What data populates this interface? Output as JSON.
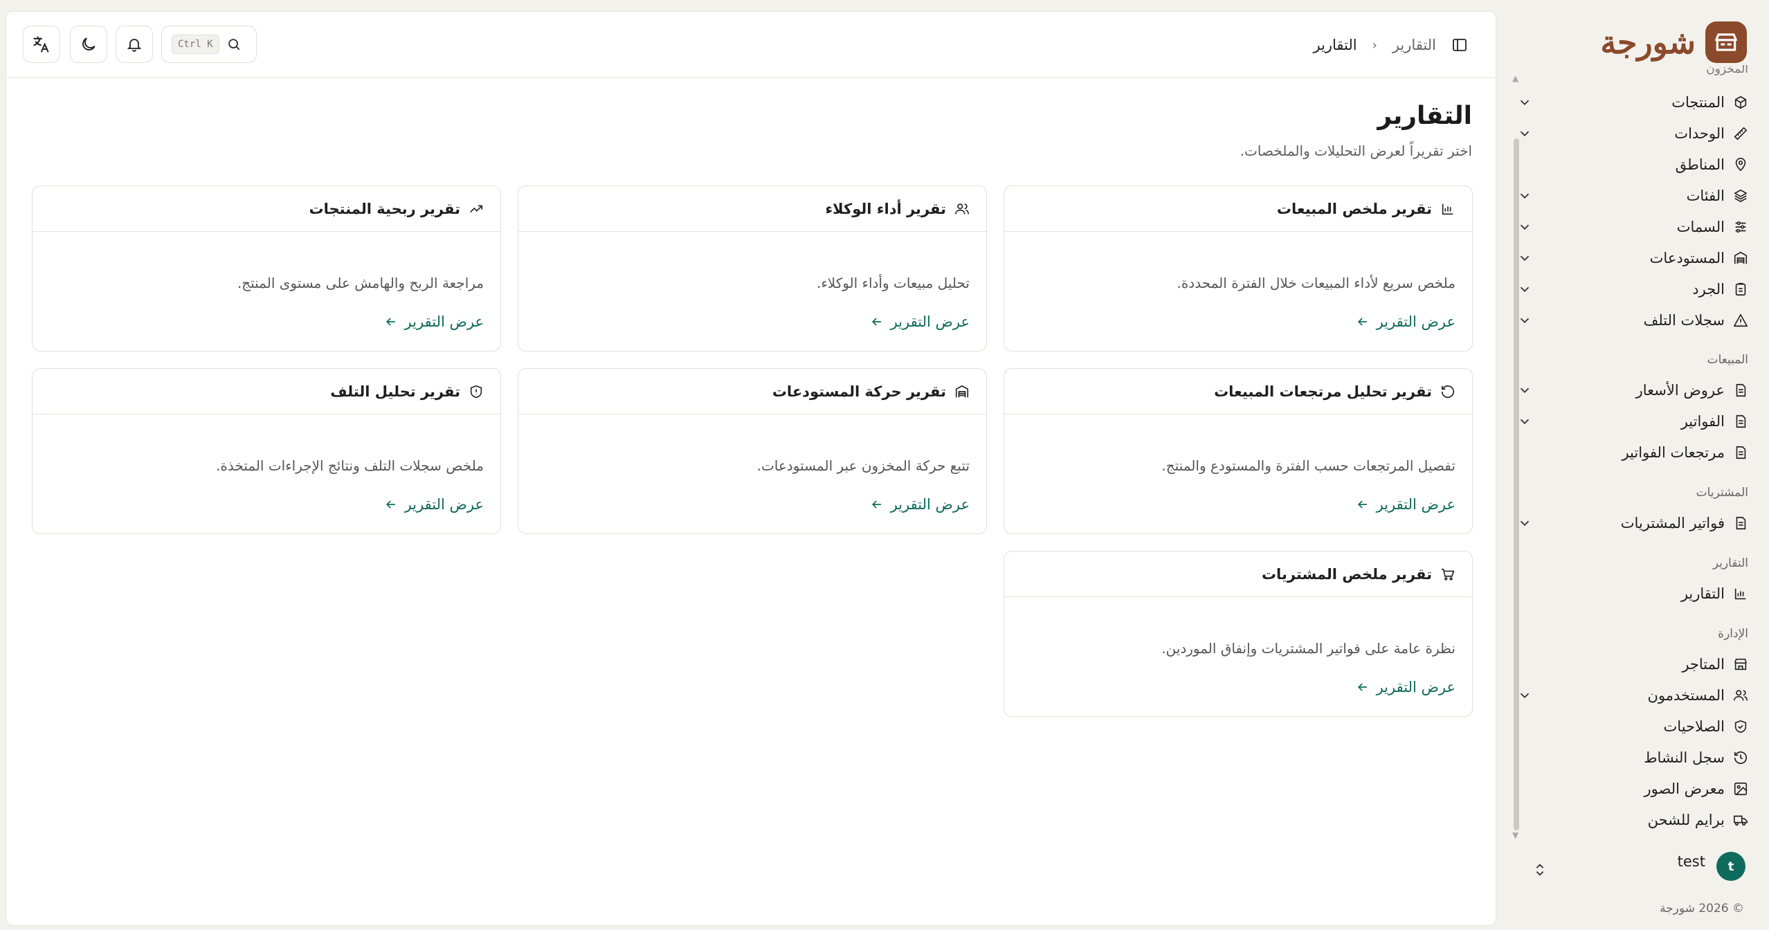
{
  "brand": {
    "name": "شورجة",
    "color": "#8b4a2b"
  },
  "sidebar": {
    "clipped_group": "المخزون",
    "groups": [
      {
        "items": [
          {
            "label": "المنتجات",
            "icon": "box-icon",
            "expandable": true
          },
          {
            "label": "الوحدات",
            "icon": "ruler-icon",
            "expandable": true
          },
          {
            "label": "المناطق",
            "icon": "map-pin-icon",
            "expandable": false
          },
          {
            "label": "الفئات",
            "icon": "layers-icon",
            "expandable": true
          },
          {
            "label": "السمات",
            "icon": "sliders-icon",
            "expandable": true
          },
          {
            "label": "المستودعات",
            "icon": "warehouse-icon",
            "expandable": true
          },
          {
            "label": "الجرد",
            "icon": "clipboard-icon",
            "expandable": true
          },
          {
            "label": "سجلات التلف",
            "icon": "alert-triangle-icon",
            "expandable": true
          }
        ]
      },
      {
        "title": "المبيعات",
        "items": [
          {
            "label": "عروض الأسعار",
            "icon": "file-icon",
            "expandable": true
          },
          {
            "label": "الفواتير",
            "icon": "file-icon",
            "expandable": true
          },
          {
            "label": "مرتجعات الفواتير",
            "icon": "file-icon",
            "expandable": false
          }
        ]
      },
      {
        "title": "المشتريات",
        "items": [
          {
            "label": "فواتير المشتريات",
            "icon": "file-icon",
            "expandable": true
          }
        ]
      },
      {
        "title": "التقارير",
        "items": [
          {
            "label": "التقارير",
            "icon": "bar-chart-icon",
            "expandable": false
          }
        ]
      },
      {
        "title": "الإدارة",
        "items": [
          {
            "label": "المتاجر",
            "icon": "store-icon",
            "expandable": false
          },
          {
            "label": "المستخدمون",
            "icon": "users-icon",
            "expandable": true
          },
          {
            "label": "الصلاحيات",
            "icon": "shield-check-icon",
            "expandable": false
          },
          {
            "label": "سجل النشاط",
            "icon": "history-icon",
            "expandable": false
          },
          {
            "label": "معرض الصور",
            "icon": "image-icon",
            "expandable": false
          },
          {
            "label": "برايم للشحن",
            "icon": "truck-icon",
            "expandable": false
          }
        ]
      }
    ],
    "user": {
      "name": "test",
      "initial": "t"
    },
    "copyright": "© 2026 شورجة"
  },
  "topbar": {
    "search_shortcut": "Ctrl K",
    "breadcrumb": [
      "التقارير",
      "التقارير"
    ]
  },
  "page": {
    "title": "التقارير",
    "subtitle": "اختر تقريراً لعرض التحليلات والملخصات."
  },
  "cards": [
    {
      "title": "تقرير ملخص المبيعات",
      "icon": "bar-chart-icon",
      "desc": "ملخص سريع لأداء المبيعات خلال الفترة المحددة.",
      "link": "عرض التقرير"
    },
    {
      "title": "تقرير أداء الوكلاء",
      "icon": "users-icon",
      "desc": "تحليل مبيعات وأداء الوكلاء.",
      "link": "عرض التقرير"
    },
    {
      "title": "تقرير ربحية المنتجات",
      "icon": "trending-up-icon",
      "desc": "مراجعة الربح والهامش على مستوى المنتج.",
      "link": "عرض التقرير"
    },
    {
      "title": "تقرير تحليل مرتجعات المبيعات",
      "icon": "rotate-ccw-icon",
      "desc": "تفصيل المرتجعات حسب الفترة والمستودع والمنتج.",
      "link": "عرض التقرير"
    },
    {
      "title": "تقرير حركة المستودعات",
      "icon": "warehouse-icon",
      "desc": "تتبع حركة المخزون عبر المستودعات.",
      "link": "عرض التقرير"
    },
    {
      "title": "تقرير تحليل التلف",
      "icon": "shield-alert-icon",
      "desc": "ملخص سجلات التلف ونتائج الإجراءات المتخذة.",
      "link": "عرض التقرير"
    },
    {
      "title": "تقرير ملخص المشتريات",
      "icon": "cart-icon",
      "desc": "نظرة عامة على فواتير المشتريات وإنفاق الموردين.",
      "link": "عرض التقرير"
    }
  ],
  "colors": {
    "accent": "#0f6b5c",
    "background": "#f3f1ec"
  }
}
